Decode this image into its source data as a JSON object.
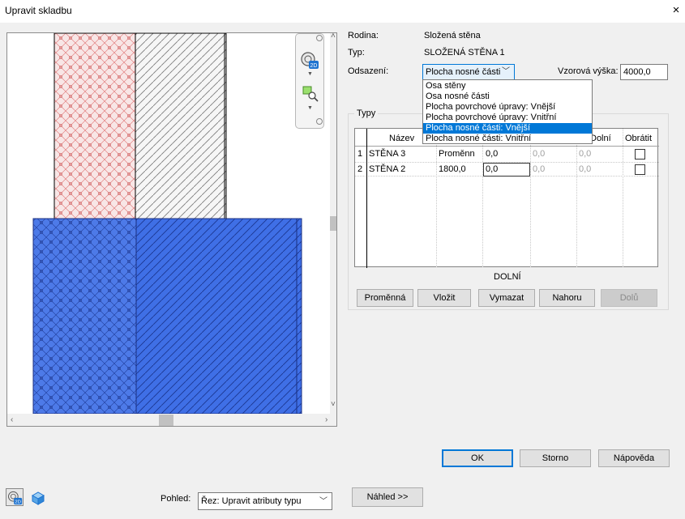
{
  "window": {
    "title": "Upravit skladbu",
    "close_label": "×"
  },
  "properties": {
    "family_label": "Rodina:",
    "family_value": "Složená stěna",
    "type_label": "Typ:",
    "type_value": "SLOŽENÁ STĚNA 1",
    "offset_label": "Odsazení:",
    "offset_value": "Plocha nosné části",
    "sample_height_label": "Vzorová výška:",
    "sample_height_value": "4000,0"
  },
  "offset_dropdown": {
    "options": [
      "Osa stěny",
      "Osa nosné části",
      "Plocha povrchové úpravy: Vnější",
      "Plocha povrchové úpravy: Vnitřní",
      "Plocha nosné části: Vnější",
      "Plocha nosné části: Vnitřní"
    ],
    "selected_index": 4
  },
  "types_group": {
    "legend": "Typy",
    "columns": [
      "Název",
      "Dolní",
      "Obrátit"
    ],
    "rows": [
      {
        "num": "1",
        "name": "STĚNA 3",
        "height": "Proměnn",
        "c1": "0,0",
        "c2": "0,0",
        "c3": "0,0",
        "flip": false
      },
      {
        "num": "2",
        "name": "STĚNA 2",
        "height": "1800,0",
        "c1": "0,0",
        "c2": "0,0",
        "c3": "0,0",
        "flip": false
      }
    ],
    "footer_label": "DOLNÍ",
    "buttons": {
      "variable": "Proměnná",
      "insert": "Vložit",
      "delete": "Vymazat",
      "up": "Nahoru",
      "down": "Dolů"
    }
  },
  "dialog_buttons": {
    "ok": "OK",
    "cancel": "Storno",
    "help": "Nápověda"
  },
  "view": {
    "label": "Pohled:",
    "value": "Řez: Upravit atributy typu",
    "preview_button": "Náhled >>"
  },
  "colors": {
    "selection": "#0078d7",
    "wall_blue": "#3f6fe6",
    "hatch_red": "#e05a5a"
  },
  "icons": {
    "orbit": "orbit-2d-icon",
    "zoom": "zoom-region-icon",
    "cube": "view-cube-icon"
  }
}
